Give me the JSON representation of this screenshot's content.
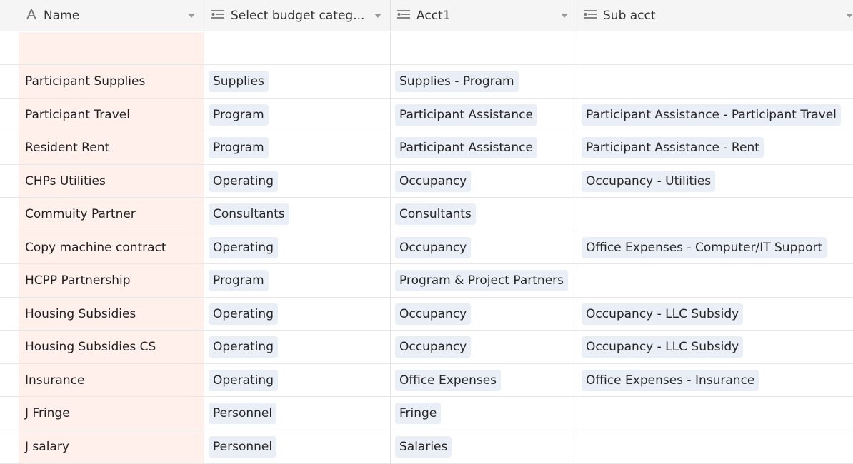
{
  "columns": [
    {
      "label": "Name",
      "icon": "text-field-icon"
    },
    {
      "label": "Select budget categ...",
      "icon": "single-select-field-icon"
    },
    {
      "label": "Acct1",
      "icon": "single-select-field-icon"
    },
    {
      "label": "Sub acct",
      "icon": "single-select-field-icon"
    }
  ],
  "rows": [
    {
      "name": "",
      "category": "",
      "acct1": "",
      "subacct": ""
    },
    {
      "name": "Participant Supplies",
      "category": "Supplies",
      "acct1": "Supplies - Program",
      "subacct": ""
    },
    {
      "name": "Participant Travel",
      "category": "Program",
      "acct1": "Participant Assistance",
      "subacct": "Participant Assistance - Participant Travel"
    },
    {
      "name": "Resident Rent",
      "category": "Program",
      "acct1": "Participant Assistance",
      "subacct": "Participant Assistance - Rent"
    },
    {
      "name": "CHPs Utilities",
      "category": "Operating",
      "acct1": "Occupancy",
      "subacct": "Occupancy - Utilities"
    },
    {
      "name": "Commuity Partner",
      "category": "Consultants",
      "acct1": "Consultants",
      "subacct": ""
    },
    {
      "name": "Copy machine contract",
      "category": "Operating",
      "acct1": "Occupancy",
      "subacct": "Office Expenses - Computer/IT Support"
    },
    {
      "name": "HCPP Partnership",
      "category": "Program",
      "acct1": "Program & Project Partners",
      "subacct": ""
    },
    {
      "name": "Housing Subsidies",
      "category": "Operating",
      "acct1": "Occupancy",
      "subacct": "Occupancy - LLC Subsidy"
    },
    {
      "name": "Housing Subsidies CS",
      "category": "Operating",
      "acct1": "Occupancy",
      "subacct": "Occupancy - LLC Subsidy"
    },
    {
      "name": "Insurance",
      "category": "Operating",
      "acct1": "Office Expenses",
      "subacct": "Office Expenses - Insurance"
    },
    {
      "name": "J Fringe",
      "category": "Personnel",
      "acct1": "Fringe",
      "subacct": ""
    },
    {
      "name": "J salary",
      "category": "Personnel",
      "acct1": "Salaries",
      "subacct": ""
    }
  ],
  "colors": {
    "name_column_bg": "#fff0ec",
    "pill_bg": "#e9eef7",
    "header_bg": "#f5f5f5"
  }
}
